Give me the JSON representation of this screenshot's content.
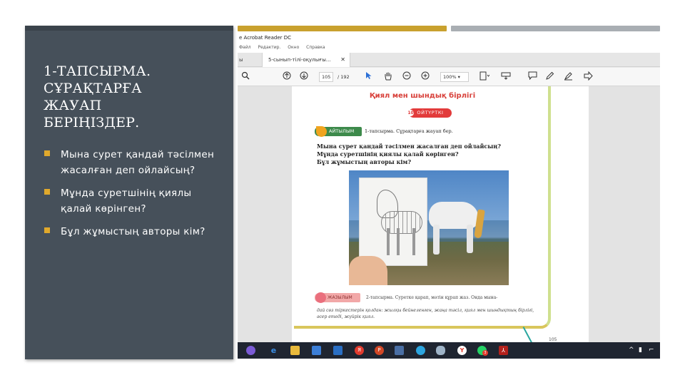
{
  "slide": {
    "title_lines": [
      "1-ТАПСЫРМА.",
      "СҰРАҚТАРҒА",
      "ЖАУАП",
      "БЕРІҢІЗДЕР."
    ],
    "bullets": [
      "Мына сурет қандай тәсілмен жасалған деп ойлайсың?",
      "Мұнда суретшінің қиялы қалай көрінген?",
      "Бұл жұмыстың авторы кім?"
    ],
    "colors": {
      "panel": "#46505a",
      "accent_gold": "#c9a12e",
      "accent_gray": "#a9aeb3",
      "bullet": "#e0a92c"
    }
  },
  "screenshot": {
    "app_title": "e Acrobat Reader DC",
    "menu": [
      "Файл",
      "Редактир.",
      "Окно",
      "Справка"
    ],
    "tabs": {
      "left_label": "ы",
      "document_tab": "5-сынып-тілі-оқулығы...",
      "close_icon": "✕"
    },
    "toolbar": {
      "page_current": "105",
      "page_total": "/ 192",
      "zoom": "100%",
      "icons": [
        "search-icon",
        "page-up-icon",
        "page-down-icon",
        "select-arrow-icon",
        "hand-icon",
        "zoom-out-icon",
        "zoom-in-icon",
        "zoom-dropdown-icon",
        "fit-page-icon",
        "keyboard-icon",
        "comment-icon",
        "pen-icon",
        "highlight-icon",
        "sign-icon"
      ]
    },
    "book_page": {
      "title": "Қиял мен шындық бірлігі",
      "lesson_number": "10",
      "lesson_label": "ОЙТҮРТКІ",
      "badge_green": "АЙТЫЛЫМ",
      "task1_label": "1-тапсырма. Сұрақтарға жауап бер.",
      "questions": [
        "Мына сурет қандай тәсілмен жасалған деп ойлайсың?",
        "Мұнда суретшінің қиялы қалай көрінген?",
        "Бұл жұмыстың авторы кім?"
      ],
      "badge_pink": "ЖАЗЫЛЫМ",
      "task2_text": "2-тапсырма. Суретке қарап, мәтін құрап жаз. Онда мына-",
      "task2_continuation": "дай сөз тіркестерін қолдан: жылқы бейнеленген, жаңа тәсіл, қиял мен шындықтың бірлігі, әсер етеді, жүйрік қиял.",
      "page_number": "105"
    },
    "taskbar": {
      "icons": [
        "cortana-icon",
        "edge-icon",
        "file-explorer-icon",
        "store-icon",
        "mail-icon",
        "yandex-icon",
        "powerpoint-icon",
        "photos-icon",
        "telegram-icon",
        "cloud-icon",
        "yandex-browser-icon",
        "whatsapp-icon",
        "acrobat-icon"
      ],
      "whatsapp_badge": "3",
      "tray": [
        "^",
        "▮",
        "⌐"
      ]
    }
  }
}
